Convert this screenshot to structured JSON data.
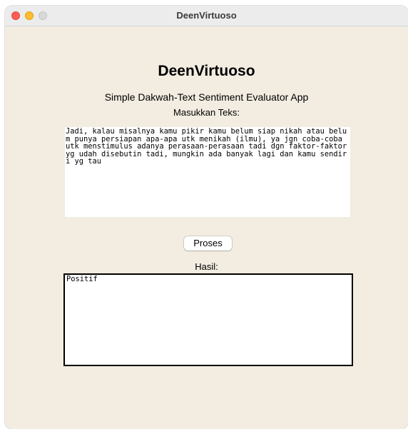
{
  "window": {
    "title": "DeenVirtuoso"
  },
  "app": {
    "heading": "DeenVirtuoso",
    "subtitle": "Simple Dakwah-Text Sentiment Evaluator App"
  },
  "input": {
    "label": "Masukkan Teks:",
    "value": "Jadi, kalau misalnya kamu pikir kamu belum siap nikah atau belum punya persiapan apa-apa utk menikah (ilmu), ya jgn coba-coba utk menstimulus adanya perasaan-perasaan tadi dgn faktor-faktor yg udah disebutin tadi, mungkin ada banyak lagi dan kamu sendiri yg tau"
  },
  "actions": {
    "process_label": "Proses"
  },
  "result": {
    "label": "Hasil:",
    "value": "Positif"
  }
}
